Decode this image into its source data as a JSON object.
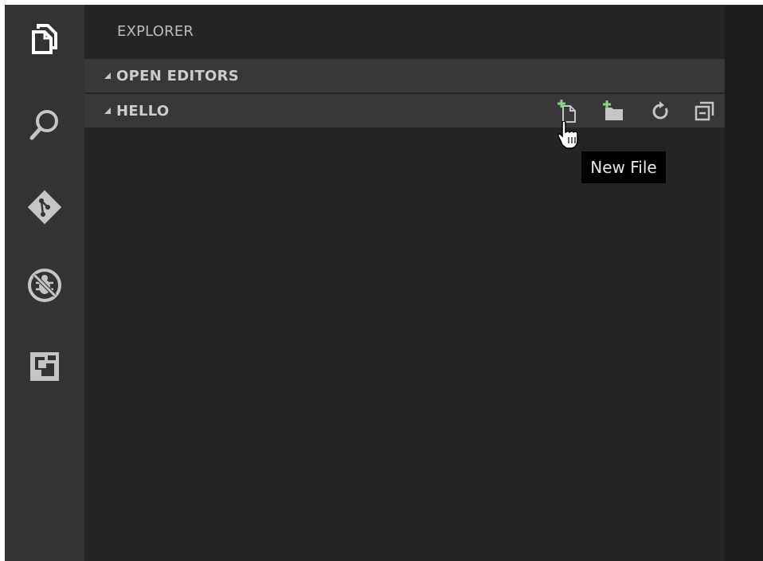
{
  "sidebar": {
    "title": "EXPLORER",
    "sections": {
      "open_editors": {
        "label": "OPEN EDITORS",
        "expanded": true
      },
      "hello": {
        "label": "HELLO",
        "expanded": true
      }
    },
    "actions": [
      {
        "name": "new-file",
        "icon": "new-file-icon"
      },
      {
        "name": "new-folder",
        "icon": "new-folder-icon"
      },
      {
        "name": "refresh",
        "icon": "refresh-icon"
      },
      {
        "name": "collapse-all",
        "icon": "collapse-all-icon"
      }
    ]
  },
  "activity_bar": {
    "items": [
      {
        "name": "explorer",
        "icon": "files-icon",
        "active": true
      },
      {
        "name": "search",
        "icon": "search-icon",
        "active": false
      },
      {
        "name": "git",
        "icon": "git-icon",
        "active": false
      },
      {
        "name": "debug",
        "icon": "debug-icon",
        "active": false
      },
      {
        "name": "extensions",
        "icon": "extensions-icon",
        "active": false
      }
    ]
  },
  "tooltip": {
    "text": "New File"
  },
  "colors": {
    "activity_bar_bg": "#333333",
    "sidebar_bg": "#252526",
    "section_header_bg": "#383838",
    "accent_green": "#89d185",
    "icon_active": "#ffffff",
    "icon_inactive": "#c5c5c5"
  }
}
